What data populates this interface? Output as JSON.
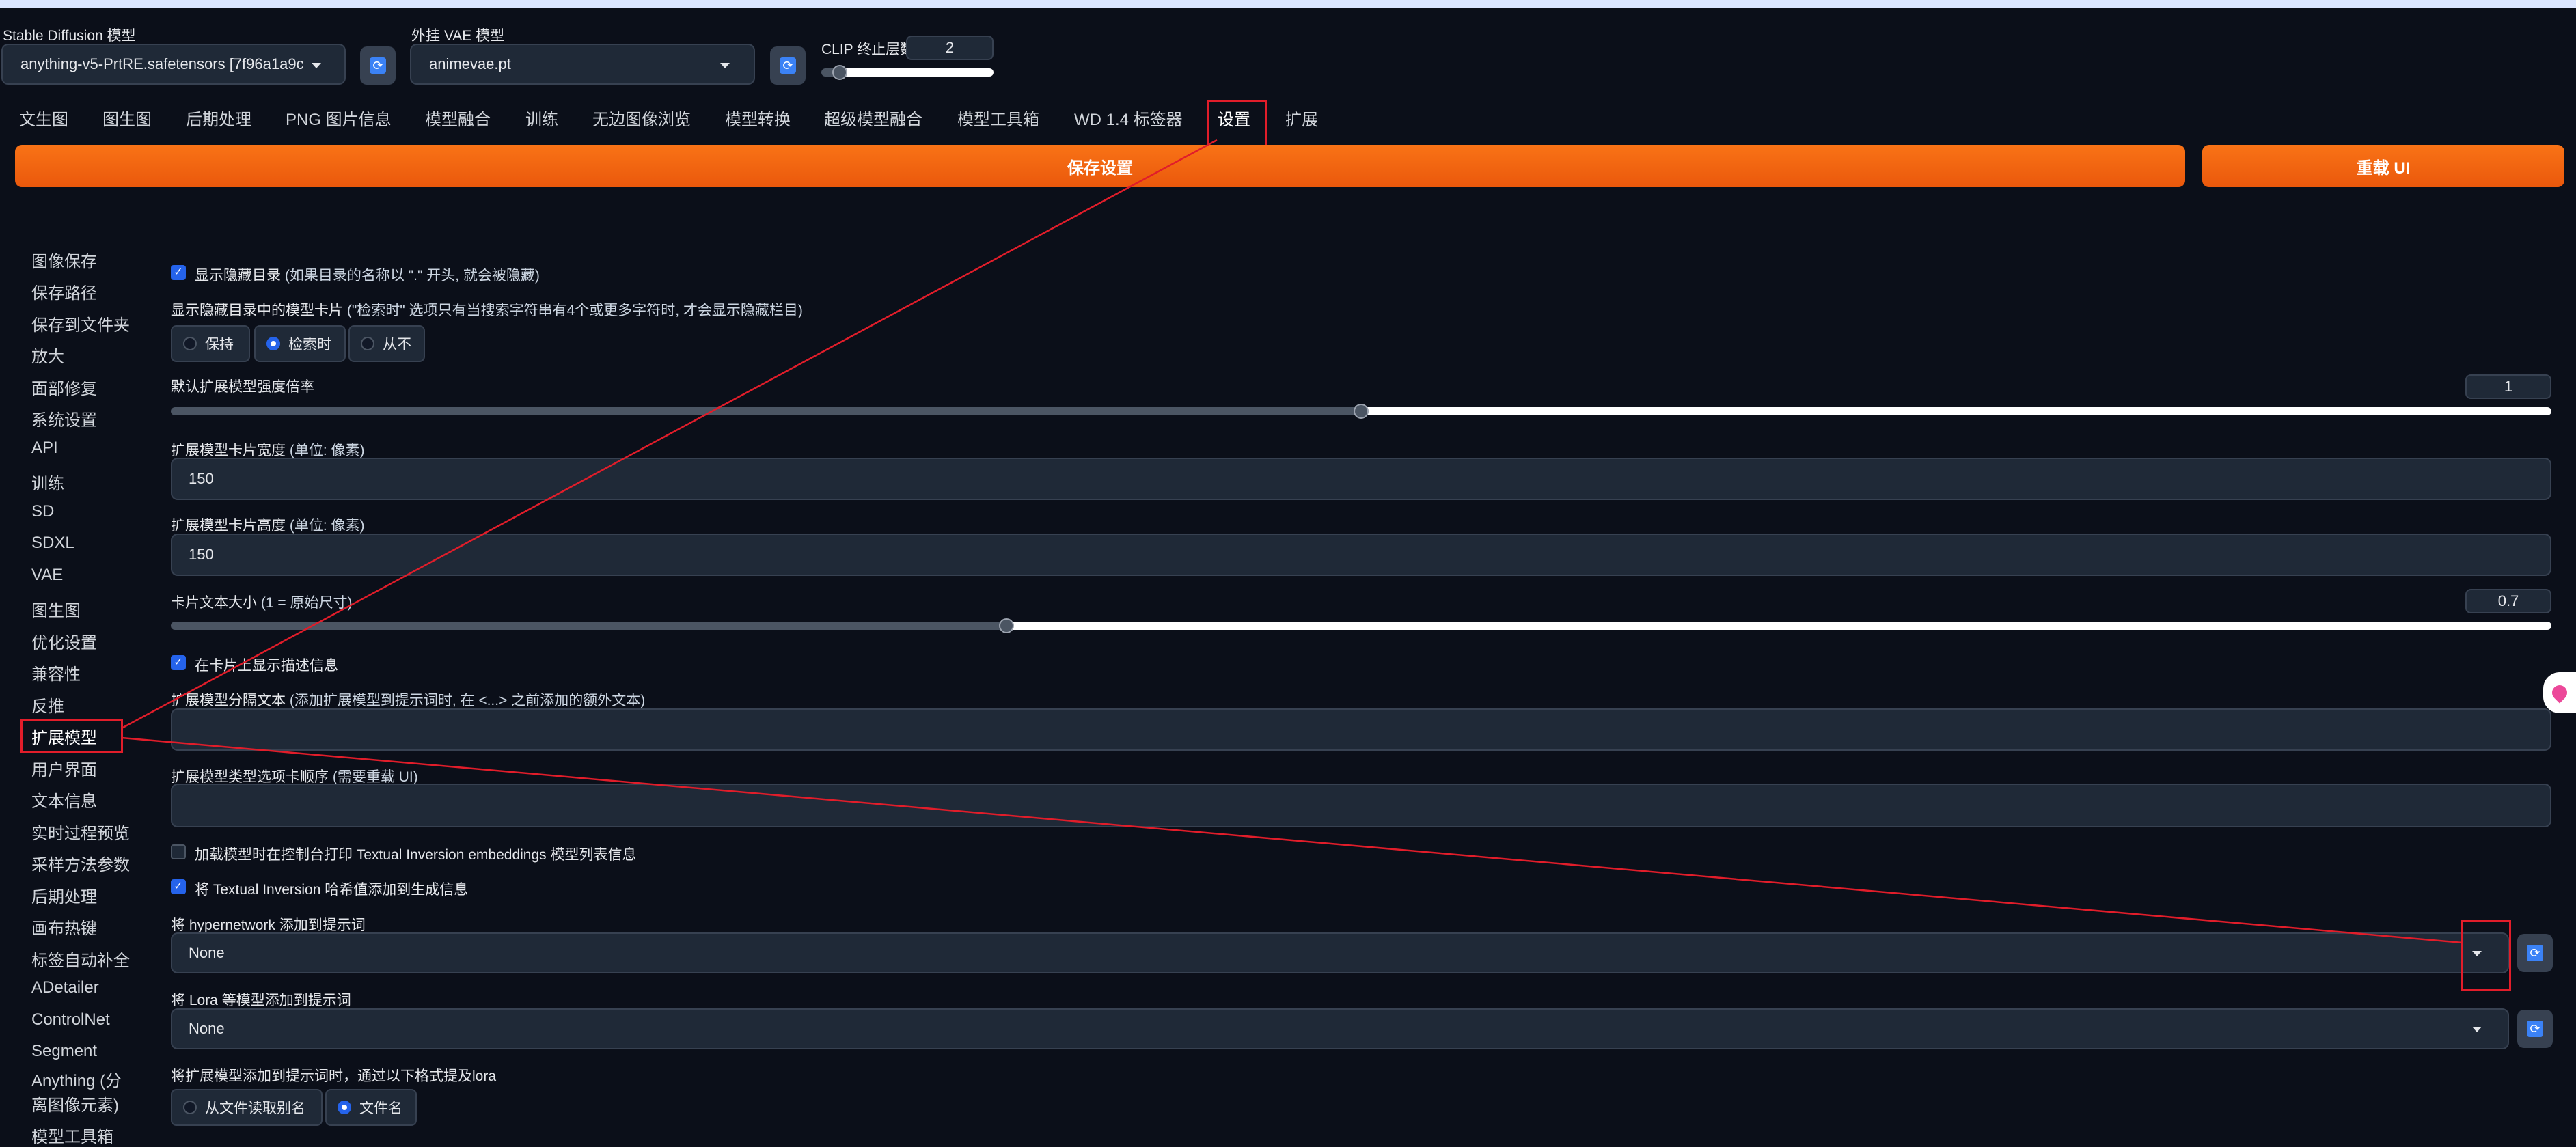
{
  "header": {
    "sd_model_label": "Stable Diffusion 模型",
    "sd_model_value": "anything-v5-PrtRE.safetensors [7f96a1a9c",
    "vae_label": "外挂 VAE 模型",
    "vae_value": "animevae.pt",
    "clip_label": "CLIP 终止层数",
    "clip_value": "2",
    "clip_slider_fraction": 0.08,
    "refresh_glyph": "⟳"
  },
  "tabs": [
    {
      "label": "文生图"
    },
    {
      "label": "图生图"
    },
    {
      "label": "后期处理"
    },
    {
      "label": "PNG 图片信息"
    },
    {
      "label": "模型融合"
    },
    {
      "label": "训练"
    },
    {
      "label": "无边图像浏览"
    },
    {
      "label": "模型转换"
    },
    {
      "label": "超级模型融合"
    },
    {
      "label": "模型工具箱"
    },
    {
      "label": "WD 1.4 标签器"
    },
    {
      "label": "设置"
    },
    {
      "label": "扩展"
    }
  ],
  "active_tab": "设置",
  "buttons": {
    "save_settings": "保存设置",
    "reload_ui": "重载 UI"
  },
  "sidebar": {
    "items": [
      "图像保存",
      "保存路径",
      "保存到文件夹",
      "放大",
      "面部修复",
      "系统设置",
      "API",
      "训练",
      "SD",
      "SDXL",
      "VAE",
      "图生图",
      "优化设置",
      "兼容性",
      "反推",
      "扩展模型",
      "用户界面",
      "文本信息",
      "实时过程预览",
      "采样方法参数",
      "后期处理",
      "画布热键",
      "标签自动补全",
      "ADetailer",
      "ControlNet",
      "Segment",
      "Anything (分",
      "离图像元素)",
      "模型工具箱"
    ],
    "selected": "扩展模型"
  },
  "settings": {
    "show_hidden_dirs": {
      "checked": true,
      "label": "显示隐藏目录",
      "hint": "(如果目录的名称以 \".\" 开头, 就会被隐藏)"
    },
    "hidden_card_mode": {
      "label": "显示隐藏目录中的模型卡片",
      "hint": "(\"检索时\" 选项只有当搜索字符串有4个或更多字符时, 才会显示隐藏栏目)",
      "options": [
        "保持",
        "检索时",
        "从不"
      ],
      "selected": "检索时"
    },
    "default_multiplier": {
      "label": "默认扩展模型强度倍率",
      "value": "1",
      "fraction": 0.5
    },
    "card_width": {
      "label": "扩展模型卡片宽度",
      "hint": "(单位: 像素)",
      "value": "150"
    },
    "card_height": {
      "label": "扩展模型卡片高度",
      "hint": "(单位: 像素)",
      "value": "150"
    },
    "card_text_scale": {
      "label": "卡片文本大小",
      "hint": "(1 = 原始尺寸)",
      "value": "0.7",
      "fraction": 0.35
    },
    "show_description": {
      "checked": true,
      "label": "在卡片上显示描述信息"
    },
    "separator": {
      "label": "扩展模型分隔文本",
      "hint": "(添加扩展模型到提示词时, 在 <...> 之前添加的额外文本)",
      "value": ""
    },
    "tab_order": {
      "label": "扩展模型类型选项卡顺序",
      "hint": "(需要重载 UI)",
      "value": ""
    },
    "print_ti": {
      "checked": false,
      "label": "加载模型时在控制台打印 Textual Inversion embeddings 模型列表信息"
    },
    "ti_hash": {
      "checked": true,
      "label": "将 Textual Inversion 哈希值添加到生成信息"
    },
    "hypernetwork": {
      "label": "将 hypernetwork 添加到提示词",
      "value": "None"
    },
    "lora": {
      "label": "将 Lora 等模型添加到提示词",
      "value": "None"
    },
    "lora_format": {
      "label": "将扩展模型添加到提示词时，通过以下格式提及lora",
      "options": [
        "从文件读取别名",
        "文件名"
      ],
      "selected": "文件名"
    }
  },
  "colors": {
    "background": "#0b0f19",
    "panel": "#1f2937",
    "accent_orange": "#f97316",
    "accent_blue": "#2563eb",
    "annotation_red": "#e11d2a"
  },
  "icons": {
    "refresh": "refresh-icon",
    "dropdown": "chevron-down-icon",
    "check": "check-icon",
    "floating": "pin-icon"
  }
}
